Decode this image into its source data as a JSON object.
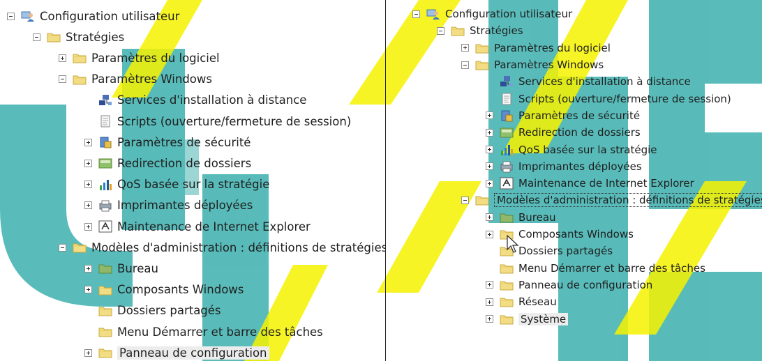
{
  "colors": {
    "teal": "#2aa9a6",
    "yellow": "#f6f200",
    "folder": "#f3dd84",
    "folder_green": "#8fb86a"
  },
  "left_tree": [
    {
      "level": 0,
      "expander": "minus",
      "icon": "user-config-icon",
      "label": "Configuration utilisateur"
    },
    {
      "level": 1,
      "expander": "minus",
      "icon": "folder-icon",
      "label": "Stratégies"
    },
    {
      "level": 2,
      "expander": "plus",
      "icon": "folder-icon",
      "label": "Paramètres du logiciel"
    },
    {
      "level": 2,
      "expander": "minus",
      "icon": "folder-icon",
      "label": "Paramètres Windows"
    },
    {
      "level": 3,
      "expander": "none",
      "icon": "network-install-icon",
      "label": "Services d'installation à distance"
    },
    {
      "level": 3,
      "expander": "none",
      "icon": "script-icon",
      "label": "Scripts (ouverture/fermeture de session)"
    },
    {
      "level": 3,
      "expander": "plus",
      "icon": "security-icon",
      "label": "Paramètres de sécurité"
    },
    {
      "level": 3,
      "expander": "plus",
      "icon": "folder-redirection-icon",
      "label": "Redirection de dossiers"
    },
    {
      "level": 3,
      "expander": "plus",
      "icon": "qos-chart-icon",
      "label": "QoS basée sur la stratégie"
    },
    {
      "level": 3,
      "expander": "plus",
      "icon": "printer-icon",
      "label": "Imprimantes déployées"
    },
    {
      "level": 3,
      "expander": "plus",
      "icon": "ie-maintenance-icon",
      "label": "Maintenance de Internet Explorer"
    },
    {
      "level": 2,
      "expander": "minus",
      "icon": "folder-icon",
      "label": "Modèles d'administration : définitions de stratégies"
    },
    {
      "level": 3,
      "expander": "plus",
      "icon": "folder-green-icon",
      "label": "Bureau"
    },
    {
      "level": 3,
      "expander": "plus",
      "icon": "folder-icon",
      "label": "Composants Windows"
    },
    {
      "level": 3,
      "expander": "none",
      "icon": "folder-icon",
      "label": "Dossiers partagés"
    },
    {
      "level": 3,
      "expander": "none",
      "icon": "folder-icon",
      "label": "Menu Démarrer et barre des tâches"
    },
    {
      "level": 3,
      "expander": "plus",
      "icon": "folder-icon",
      "label": "Panneau de configuration",
      "selected": true
    }
  ],
  "right_tree": [
    {
      "level": 0,
      "expander": "minus",
      "icon": "user-config-icon",
      "label": "Configuration utilisateur"
    },
    {
      "level": 1,
      "expander": "minus",
      "icon": "folder-icon",
      "label": "Stratégies"
    },
    {
      "level": 2,
      "expander": "plus",
      "icon": "folder-icon",
      "label": "Paramètres du logiciel"
    },
    {
      "level": 2,
      "expander": "minus",
      "icon": "folder-icon",
      "label": "Paramètres Windows"
    },
    {
      "level": 3,
      "expander": "none",
      "icon": "network-install-icon",
      "label": "Services d'installation à distance"
    },
    {
      "level": 3,
      "expander": "none",
      "icon": "script-icon",
      "label": "Scripts (ouverture/fermeture de session)"
    },
    {
      "level": 3,
      "expander": "plus",
      "icon": "security-icon",
      "label": "Paramètres de sécurité"
    },
    {
      "level": 3,
      "expander": "plus",
      "icon": "folder-redirection-icon",
      "label": "Redirection de dossiers"
    },
    {
      "level": 3,
      "expander": "plus",
      "icon": "qos-chart-icon",
      "label": "QoS basée sur la stratégie"
    },
    {
      "level": 3,
      "expander": "plus",
      "icon": "printer-icon",
      "label": "Imprimantes déployées"
    },
    {
      "level": 3,
      "expander": "plus",
      "icon": "ie-maintenance-icon",
      "label": "Maintenance de Internet Explorer"
    },
    {
      "level": 2,
      "expander": "minus",
      "icon": "folder-icon",
      "label": "Modèles d'administration : définitions de stratégies",
      "focused": true
    },
    {
      "level": 3,
      "expander": "plus",
      "icon": "folder-green-icon",
      "label": "Bureau"
    },
    {
      "level": 3,
      "expander": "plus",
      "icon": "folder-icon",
      "label": "Composants Windows"
    },
    {
      "level": 3,
      "expander": "none",
      "icon": "folder-icon",
      "label": "Dossiers partagés"
    },
    {
      "level": 3,
      "expander": "none",
      "icon": "folder-icon",
      "label": "Menu Démarrer et barre des tâches"
    },
    {
      "level": 3,
      "expander": "plus",
      "icon": "folder-icon",
      "label": "Panneau de configuration"
    },
    {
      "level": 3,
      "expander": "plus",
      "icon": "folder-icon",
      "label": "Réseau"
    },
    {
      "level": 3,
      "expander": "plus",
      "icon": "folder-icon",
      "label": "Système",
      "selected": true
    }
  ]
}
